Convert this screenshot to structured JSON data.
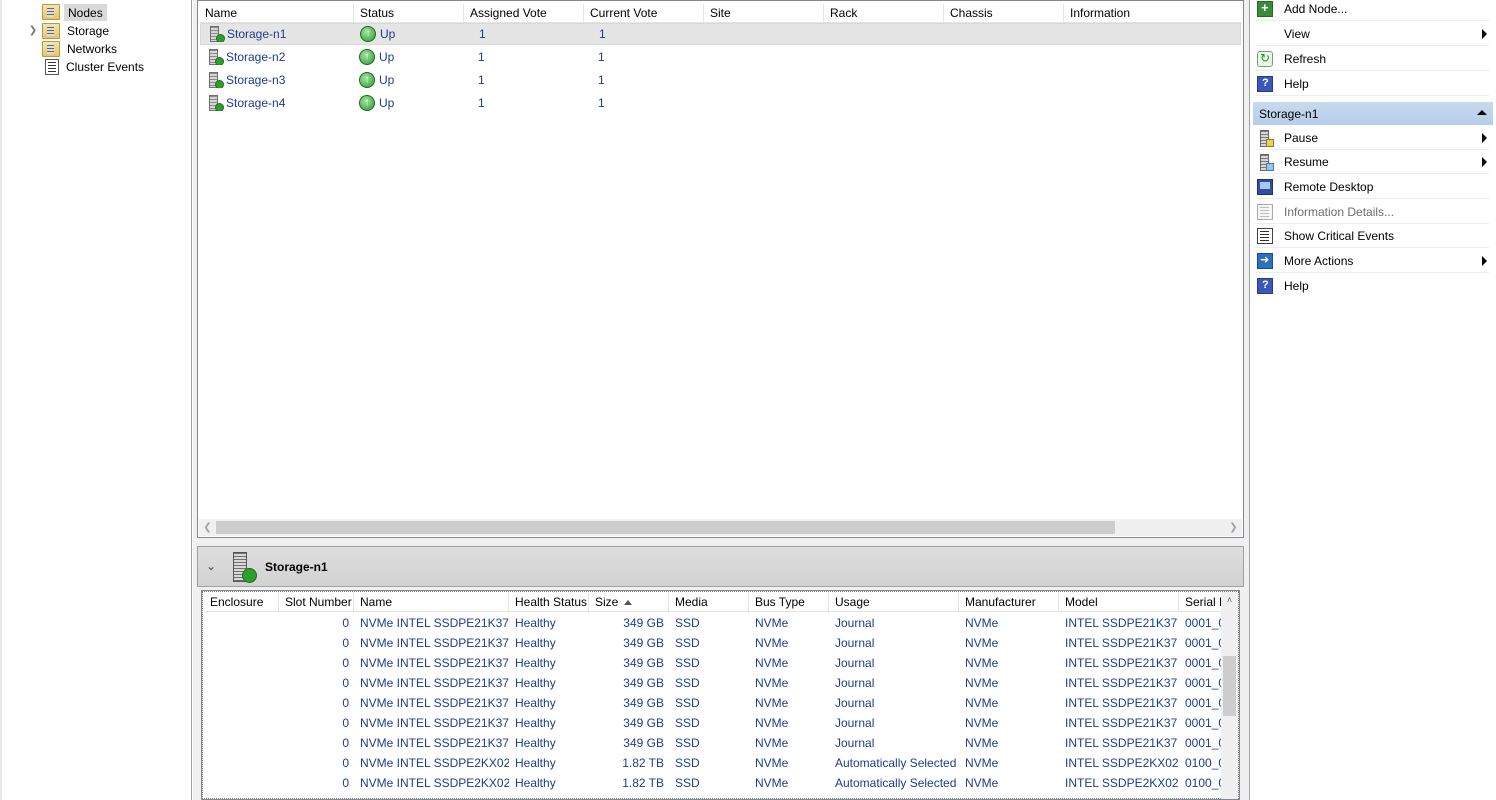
{
  "tree": {
    "items": [
      {
        "label": "Nodes",
        "selected": true,
        "icon": "nodes-folder-icon"
      },
      {
        "label": "Storage",
        "selected": false,
        "icon": "storage-folder-icon"
      },
      {
        "label": "Networks",
        "selected": false,
        "icon": "networks-folder-icon"
      },
      {
        "label": "Cluster Events",
        "selected": false,
        "icon": "cluster-events-icon"
      }
    ]
  },
  "nodes_grid": {
    "columns": [
      "Name",
      "Status",
      "Assigned Vote",
      "Current Vote",
      "Site",
      "Rack",
      "Chassis",
      "Information"
    ],
    "rows": [
      {
        "name": "Storage-n1",
        "status": "Up",
        "assigned_vote": "1",
        "current_vote": "1"
      },
      {
        "name": "Storage-n2",
        "status": "Up",
        "assigned_vote": "1",
        "current_vote": "1"
      },
      {
        "name": "Storage-n3",
        "status": "Up",
        "assigned_vote": "1",
        "current_vote": "1"
      },
      {
        "name": "Storage-n4",
        "status": "Up",
        "assigned_vote": "1",
        "current_vote": "1"
      }
    ]
  },
  "details": {
    "title": "Storage-n1",
    "columns": [
      "Enclosure",
      "Slot Number",
      "Name",
      "Health Status",
      "Size",
      "Media",
      "Bus Type",
      "Usage",
      "Manufacturer",
      "Model",
      "Serial N"
    ],
    "sorted_column": "Size",
    "rows": [
      {
        "enclosure": "",
        "slot": "0",
        "name": "NVMe INTEL SSDPE21K37",
        "health": "Healthy",
        "size": "349 GB",
        "media": "SSD",
        "bus": "NVMe",
        "usage": "Journal",
        "manufacturer": "NVMe",
        "model": "INTEL SSDPE21K37",
        "serial": "0001_0"
      },
      {
        "enclosure": "",
        "slot": "0",
        "name": "NVMe INTEL SSDPE21K37",
        "health": "Healthy",
        "size": "349 GB",
        "media": "SSD",
        "bus": "NVMe",
        "usage": "Journal",
        "manufacturer": "NVMe",
        "model": "INTEL SSDPE21K37",
        "serial": "0001_0"
      },
      {
        "enclosure": "",
        "slot": "0",
        "name": "NVMe INTEL SSDPE21K37",
        "health": "Healthy",
        "size": "349 GB",
        "media": "SSD",
        "bus": "NVMe",
        "usage": "Journal",
        "manufacturer": "NVMe",
        "model": "INTEL SSDPE21K37",
        "serial": "0001_0"
      },
      {
        "enclosure": "",
        "slot": "0",
        "name": "NVMe INTEL SSDPE21K37",
        "health": "Healthy",
        "size": "349 GB",
        "media": "SSD",
        "bus": "NVMe",
        "usage": "Journal",
        "manufacturer": "NVMe",
        "model": "INTEL SSDPE21K37",
        "serial": "0001_0"
      },
      {
        "enclosure": "",
        "slot": "0",
        "name": "NVMe INTEL SSDPE21K37",
        "health": "Healthy",
        "size": "349 GB",
        "media": "SSD",
        "bus": "NVMe",
        "usage": "Journal",
        "manufacturer": "NVMe",
        "model": "INTEL SSDPE21K37",
        "serial": "0001_0"
      },
      {
        "enclosure": "",
        "slot": "0",
        "name": "NVMe INTEL SSDPE21K37",
        "health": "Healthy",
        "size": "349 GB",
        "media": "SSD",
        "bus": "NVMe",
        "usage": "Journal",
        "manufacturer": "NVMe",
        "model": "INTEL SSDPE21K37",
        "serial": "0001_0"
      },
      {
        "enclosure": "",
        "slot": "0",
        "name": "NVMe INTEL SSDPE21K37",
        "health": "Healthy",
        "size": "349 GB",
        "media": "SSD",
        "bus": "NVMe",
        "usage": "Journal",
        "manufacturer": "NVMe",
        "model": "INTEL SSDPE21K37",
        "serial": "0001_0"
      },
      {
        "enclosure": "",
        "slot": "0",
        "name": "NVMe INTEL SSDPE2KX02",
        "health": "Healthy",
        "size": "1.82 TB",
        "media": "SSD",
        "bus": "NVMe",
        "usage": "Automatically Selected",
        "manufacturer": "NVMe",
        "model": "INTEL SSDPE2KX02",
        "serial": "0100_0"
      },
      {
        "enclosure": "",
        "slot": "0",
        "name": "NVMe INTEL SSDPE2KX02",
        "health": "Healthy",
        "size": "1.82 TB",
        "media": "SSD",
        "bus": "NVMe",
        "usage": "Automatically Selected",
        "manufacturer": "NVMe",
        "model": "INTEL SSDPE2KX02",
        "serial": "0100_0"
      }
    ]
  },
  "actions": {
    "top": [
      {
        "label": "Add Node...",
        "icon": "add-node-icon",
        "submenu": false
      },
      {
        "label": "View",
        "icon": "",
        "submenu": true
      },
      {
        "label": "Refresh",
        "icon": "refresh-icon",
        "submenu": false
      },
      {
        "label": "Help",
        "icon": "help-icon",
        "submenu": false
      }
    ],
    "section_title": "Storage-n1",
    "node": [
      {
        "label": "Pause",
        "icon": "pause-node-icon",
        "submenu": true,
        "disabled": false
      },
      {
        "label": "Resume",
        "icon": "resume-node-icon",
        "submenu": true,
        "disabled": false
      },
      {
        "label": "Remote Desktop",
        "icon": "remote-desktop-icon",
        "submenu": false,
        "disabled": false
      },
      {
        "label": "Information Details...",
        "icon": "information-details-icon",
        "submenu": false,
        "disabled": true
      },
      {
        "label": "Show Critical Events",
        "icon": "critical-events-icon",
        "submenu": false,
        "disabled": false
      },
      {
        "label": "More Actions",
        "icon": "more-actions-icon",
        "submenu": true,
        "disabled": false
      },
      {
        "label": "Help",
        "icon": "help-icon",
        "submenu": false,
        "disabled": false
      }
    ]
  }
}
